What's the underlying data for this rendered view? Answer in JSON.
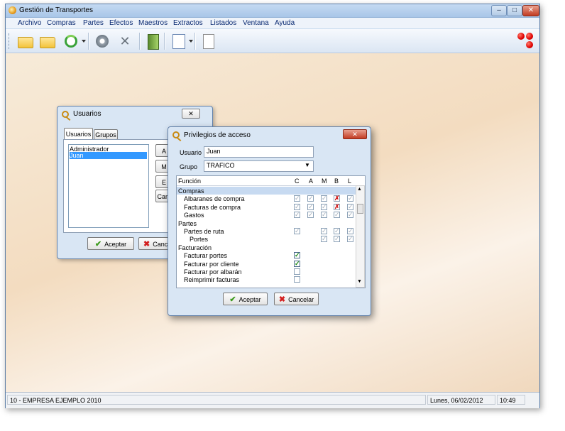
{
  "window": {
    "title": "Gestión de Transportes",
    "min": "–",
    "max": "□",
    "close": "✕"
  },
  "menu": [
    "Archivo",
    "Compras",
    "Partes",
    "Efectos",
    "Maestros",
    "Extractos",
    "Listados",
    "Ventana",
    "Ayuda"
  ],
  "toolbar_icons": [
    "folder-icon",
    "folder-icon",
    "refresh-icon",
    "gear-icon",
    "tools-icon",
    "exit-icon",
    "search-icon",
    "document-icon"
  ],
  "status": {
    "company": "10 - EMPRESA EJEMPLO 2010",
    "date": "Lunes, 06/02/2012",
    "time": "10:49"
  },
  "usuarios": {
    "title": "Usuarios",
    "close": "✕",
    "tabs": [
      "Usuarios",
      "Grupos"
    ],
    "users": [
      "Administrador",
      "Juan"
    ],
    "selected_user": "Juan",
    "side_buttons": [
      "A",
      "M",
      "E",
      "Cam"
    ],
    "ok": "Aceptar",
    "cancel": "Canc"
  },
  "privilegios": {
    "title": "Privilegios de acceso",
    "close": "✕",
    "usuario_label": "Usuario",
    "usuario_value": "Juan",
    "grupo_label": "Grupo",
    "grupo_value": "TRAFICO",
    "columns": {
      "funcion": "Función",
      "c": "C",
      "a": "A",
      "m": "M",
      "b": "B",
      "l": "L"
    },
    "rows": [
      {
        "label": "Compras",
        "section": true,
        "selected": true,
        "checks": []
      },
      {
        "label": "Albaranes de compra",
        "indent": 1,
        "checks": [
          "on",
          "on",
          "on",
          "x",
          "on"
        ]
      },
      {
        "label": "Facturas de compra",
        "indent": 1,
        "checks": [
          "on",
          "on",
          "on",
          "x",
          "on"
        ]
      },
      {
        "label": "Gastos",
        "indent": 1,
        "checks": [
          "on",
          "on",
          "on",
          "on",
          "on"
        ]
      },
      {
        "label": "Partes",
        "section": true,
        "checks": []
      },
      {
        "label": "Partes de ruta",
        "indent": 1,
        "checks": [
          "on",
          "",
          "on",
          "on",
          "on"
        ]
      },
      {
        "label": "Portes",
        "indent": 2,
        "checks": [
          "",
          "",
          "on",
          "on",
          "on"
        ]
      },
      {
        "label": "Facturación",
        "section": true,
        "checks": []
      },
      {
        "label": "Facturar portes",
        "indent": 1,
        "checks": [
          "green"
        ]
      },
      {
        "label": "Facturar por cliente",
        "indent": 1,
        "checks": [
          "green"
        ]
      },
      {
        "label": "Facturar por albarán",
        "indent": 1,
        "checks": [
          "empty"
        ]
      },
      {
        "label": "Reimprimir facturas",
        "indent": 1,
        "checks": [
          "empty"
        ]
      }
    ],
    "ok": "Aceptar",
    "cancel": "Cancelar"
  },
  "colors": {
    "title_bar": "#b7d0ec",
    "accent": "#0a2a72",
    "logo_red": "#e00000"
  }
}
